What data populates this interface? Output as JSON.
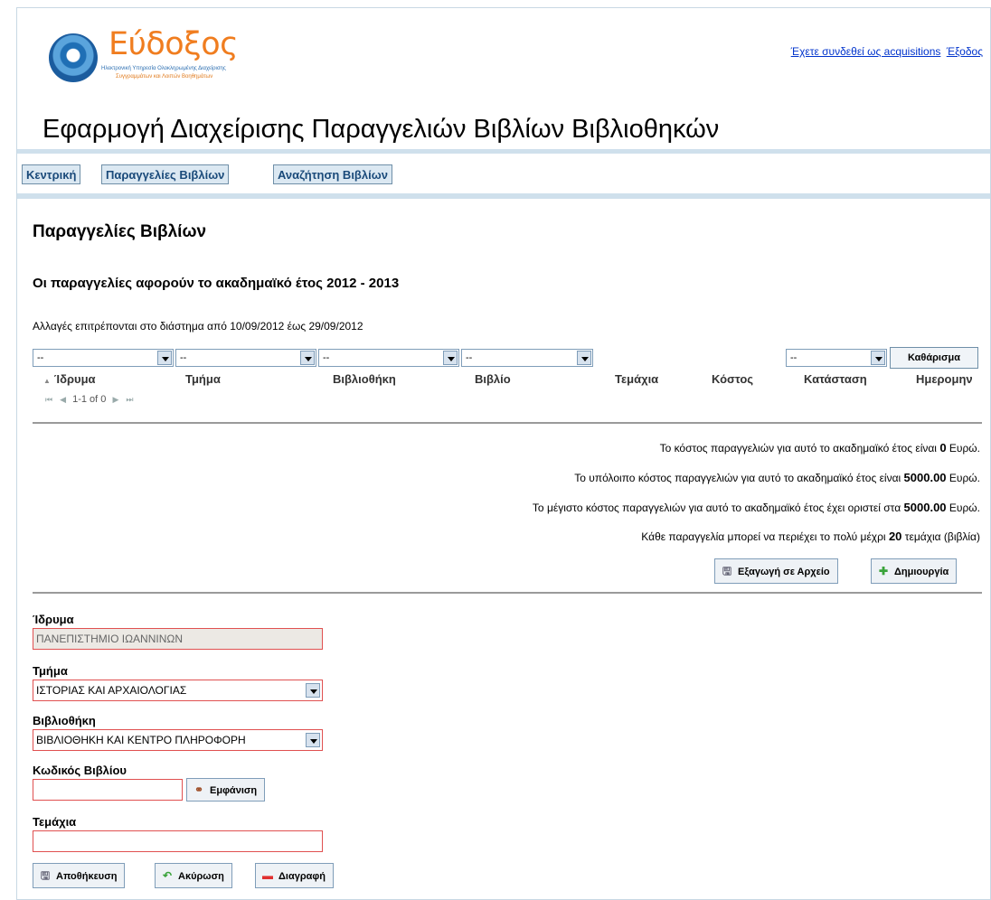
{
  "header": {
    "logo_title": "Εύδοξος",
    "logo_sub1": "Ηλεκτρονική Υπηρεσία Ολοκληρωμένης Διαχείρισης",
    "logo_sub2": "Συγγραμμάτων και Λοιπών Βοηθημάτων",
    "logged_in_text": "Έχετε συνδεθεί ως acquisitions",
    "logout_text": "Έξοδος",
    "app_title": "Εφαρμογή Διαχείρισης Παραγγελιών Βιβλίων Βιβλιοθηκών"
  },
  "nav": {
    "items": [
      {
        "label": "Κεντρική"
      },
      {
        "label": "Παραγγελίες Βιβλίων"
      },
      {
        "label": "Αναζήτηση Βιβλίων"
      }
    ]
  },
  "main": {
    "page_title": "Παραγγελίες Βιβλίων",
    "year_line": "Οι παραγγελίες αφορούν το ακαδημαϊκό έτος 2012 - 2013",
    "changes_line": "Αλλαγές επιτρέπονται στο διάστημα από 10/09/2012 έως 29/09/2012",
    "filters": {
      "institution": "--",
      "department": "--",
      "library": "--",
      "book": "--",
      "status": "--",
      "clear_label": "Καθάρισμα"
    },
    "columns": [
      "Ίδρυμα",
      "Τμήμα",
      "Βιβλιοθήκη",
      "Βιβλίο",
      "Τεμάχια",
      "Κόστος",
      "Κατάσταση",
      "Ημερομην"
    ],
    "pager_text": "1-1 of 0",
    "info": {
      "cost_prefix": "Το κόστος παραγγελιών για αυτό το ακαδημαϊκό έτος είναι",
      "cost_value": "0",
      "cost_suffix": "Ευρώ.",
      "remaining_prefix": "Το υπόλοιπο κόστος παραγγελιών για αυτό το ακαδημαϊκό έτος είναι",
      "remaining_value": "5000.00",
      "remaining_suffix": "Ευρώ.",
      "max_prefix": "Το μέγιστο κόστος παραγγελιών για αυτό το ακαδημαϊκό έτος έχει οριστεί στα",
      "max_value": "5000.00",
      "max_suffix": "Ευρώ.",
      "items_prefix": "Κάθε παραγγελία μπορεί να περιέχει το πολύ μέχρι",
      "items_value": "20",
      "items_suffix": "τεμάχια (βιβλία)"
    },
    "export_label": "Εξαγωγή σε Αρχείο",
    "create_label": "Δημιουργία"
  },
  "form": {
    "institution_label": "Ίδρυμα",
    "institution_value": "ΠΑΝΕΠΙΣΤΗΜΙΟ ΙΩΑΝΝΙΝΩΝ",
    "department_label": "Τμήμα",
    "department_value": "ΙΣΤΟΡΙΑΣ ΚΑΙ ΑΡΧΑΙΟΛΟΓΙΑΣ",
    "library_label": "Βιβλιοθήκη",
    "library_value": "ΒΙΒΛΙΟΘΗΚΗ ΚΑΙ ΚΕΝΤΡΟ ΠΛΗΡΟΦΟΡΗ",
    "book_code_label": "Κωδικός Βιβλίου",
    "book_code_value": "",
    "show_label": "Εμφάνιση",
    "items_label": "Τεμάχια",
    "items_value": "",
    "save_label": "Αποθήκευση",
    "cancel_label": "Ακύρωση",
    "delete_label": "Διαγραφή"
  },
  "colors": {
    "accent_orange": "#f07d1f",
    "nav_bg": "#dbe8f2",
    "band": "#cfe0ec",
    "required_border": "#e05050"
  }
}
